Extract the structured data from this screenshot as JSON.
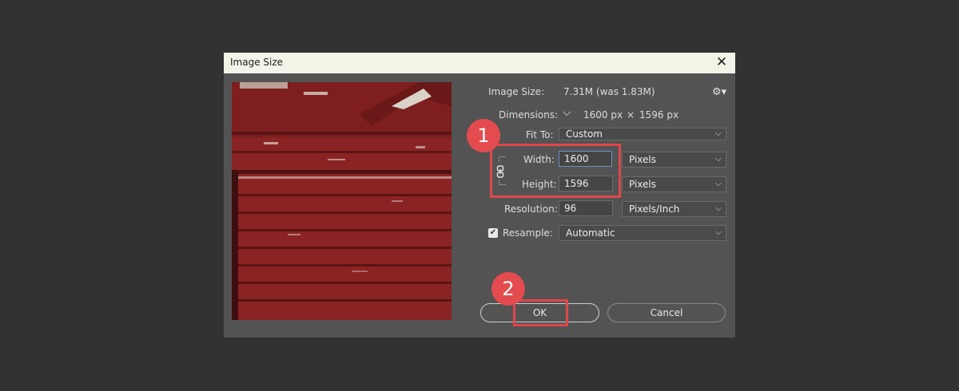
{
  "dialog": {
    "title": "Image Size",
    "close_glyph": "✕"
  },
  "info": {
    "image_size_label": "Image Size:",
    "image_size_value": "7.31M (was 1.83M)",
    "dimensions_label": "Dimensions:",
    "dimensions_chevron": "⌵",
    "dimensions_width": "1600 px",
    "dimensions_x": "×",
    "dimensions_height": "1596 px",
    "gear_glyph": "⚙▾"
  },
  "fit_to": {
    "label": "Fit To:",
    "value": "Custom"
  },
  "width": {
    "label": "Width:",
    "value": "1600",
    "unit": "Pixels"
  },
  "height": {
    "label": "Height:",
    "value": "1596",
    "unit": "Pixels"
  },
  "resolution": {
    "label": "Resolution:",
    "value": "96",
    "unit": "Pixels/Inch"
  },
  "resample": {
    "label": "Resample:",
    "value": "Automatic",
    "checked": true
  },
  "buttons": {
    "ok": "OK",
    "cancel": "Cancel"
  },
  "chevron": "⌵",
  "annotations": [
    {
      "number": "1"
    },
    {
      "number": "2"
    }
  ],
  "colors": {
    "dialog_bg": "#535353",
    "titlebar_bg": "#f1f5e7",
    "callout": "#e1474b",
    "preview_red": "#8c2222"
  }
}
